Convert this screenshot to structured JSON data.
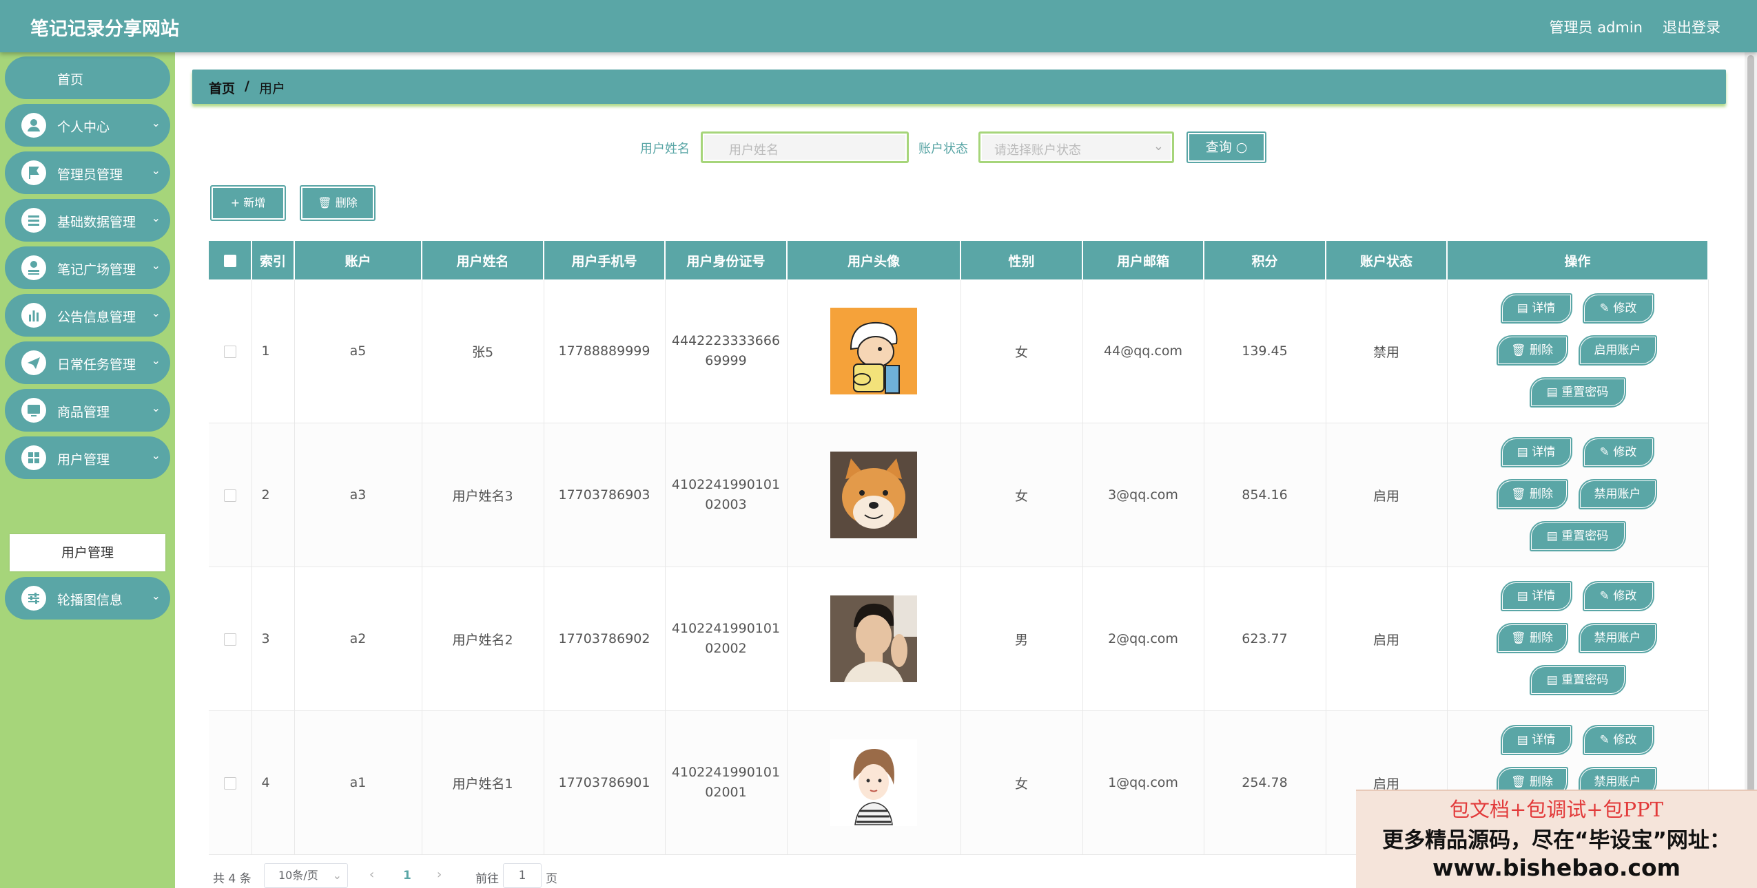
{
  "header": {
    "site_title": "笔记记录分享网站",
    "user_label": "管理员 admin",
    "logout_label": "退出登录"
  },
  "sidebar": {
    "home": "首页",
    "items": [
      {
        "label": "个人中心",
        "icon": "user-icon"
      },
      {
        "label": "管理员管理",
        "icon": "flag-icon"
      },
      {
        "label": "基础数据管理",
        "icon": "list-icon"
      },
      {
        "label": "笔记广场管理",
        "icon": "user-upload-icon"
      },
      {
        "label": "公告信息管理",
        "icon": "bar-chart-icon"
      },
      {
        "label": "日常任务管理",
        "icon": "send-icon"
      },
      {
        "label": "商品管理",
        "icon": "monitor-icon"
      },
      {
        "label": "用户管理",
        "icon": "grid-icon"
      },
      {
        "label": "轮播图信息",
        "icon": "sliders-icon"
      }
    ],
    "active_sub": "用户管理"
  },
  "breadcrumb": {
    "home": "首页",
    "separator": "/",
    "current": "用户"
  },
  "search": {
    "name_label": "用户姓名",
    "name_placeholder": "用户姓名",
    "status_label": "账户状态",
    "status_placeholder": "请选择账户状态",
    "query_label": "查询 ○"
  },
  "toolbar": {
    "add_label": "+ 新增",
    "delete_label": "删除"
  },
  "table": {
    "columns": [
      "索引",
      "账户",
      "用户姓名",
      "用户手机号",
      "用户身份证号",
      "用户头像",
      "性别",
      "用户邮箱",
      "积分",
      "账户状态",
      "操作"
    ],
    "rows": [
      {
        "index": "1",
        "account": "a5",
        "name": "张5",
        "phone": "17788889999",
        "idcard": "444222333366669999",
        "avatar": "cartoon-boy-avatar",
        "gender": "女",
        "email": "44@qq.com",
        "points": "139.45",
        "status": "禁用",
        "toggle": "启用账户"
      },
      {
        "index": "2",
        "account": "a3",
        "name": "用户姓名3",
        "phone": "17703786903",
        "idcard": "410224199010102003",
        "avatar": "shiba-dog-avatar",
        "gender": "女",
        "email": "3@qq.com",
        "points": "854.16",
        "status": "启用",
        "toggle": "禁用账户"
      },
      {
        "index": "3",
        "account": "a2",
        "name": "用户姓名2",
        "phone": "17703786902",
        "idcard": "410224199010102002",
        "avatar": "young-man-avatar",
        "gender": "男",
        "email": "2@qq.com",
        "points": "623.77",
        "status": "启用",
        "toggle": "禁用账户"
      },
      {
        "index": "4",
        "account": "a1",
        "name": "用户姓名1",
        "phone": "17703786901",
        "idcard": "410224199010102001",
        "avatar": "drawn-girl-avatar",
        "gender": "女",
        "email": "1@qq.com",
        "points": "254.78",
        "status": "启用",
        "toggle": "禁用账户"
      }
    ],
    "op_labels": {
      "detail": "详情",
      "edit": "修改",
      "delete": "删除",
      "reset": "重置密码"
    }
  },
  "pagination": {
    "total": "共 4 条",
    "page_size": "10条/页",
    "current_page": "1",
    "goto_label": "前往",
    "goto_value": "1",
    "unit": "页"
  },
  "promo": {
    "line1": "包文档+包调试+包PPT",
    "line2": "更多精品源码，尽在“毕设宝”网址：",
    "line3": "www.bishebao.com"
  },
  "colors": {
    "primary": "#5aa6a6",
    "sidebar_bg": "#a6d57a"
  }
}
